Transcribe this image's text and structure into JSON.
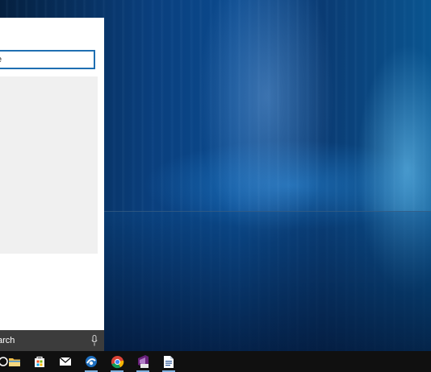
{
  "colors": {
    "accent": "#1f6fb2",
    "taskbar": "#101010",
    "search_bar": "#3c3c3c",
    "panel": "#ffffff",
    "results_bg": "#f0f0f0"
  },
  "start_panel": {
    "search_box_text": "e"
  },
  "search_bar": {
    "label": "arch",
    "mic_icon": "microphone-icon"
  },
  "taskbar": {
    "items": [
      {
        "icon": "cortana-icon",
        "active": false
      },
      {
        "icon": "file-explorer-icon",
        "active": false
      },
      {
        "icon": "store-icon",
        "active": false
      },
      {
        "icon": "mail-icon",
        "active": false
      },
      {
        "icon": "app-icon",
        "active": true
      },
      {
        "icon": "chrome-icon",
        "active": true
      },
      {
        "icon": "visual-studio-icon",
        "active": true
      },
      {
        "icon": "document-icon",
        "active": true
      }
    ]
  }
}
